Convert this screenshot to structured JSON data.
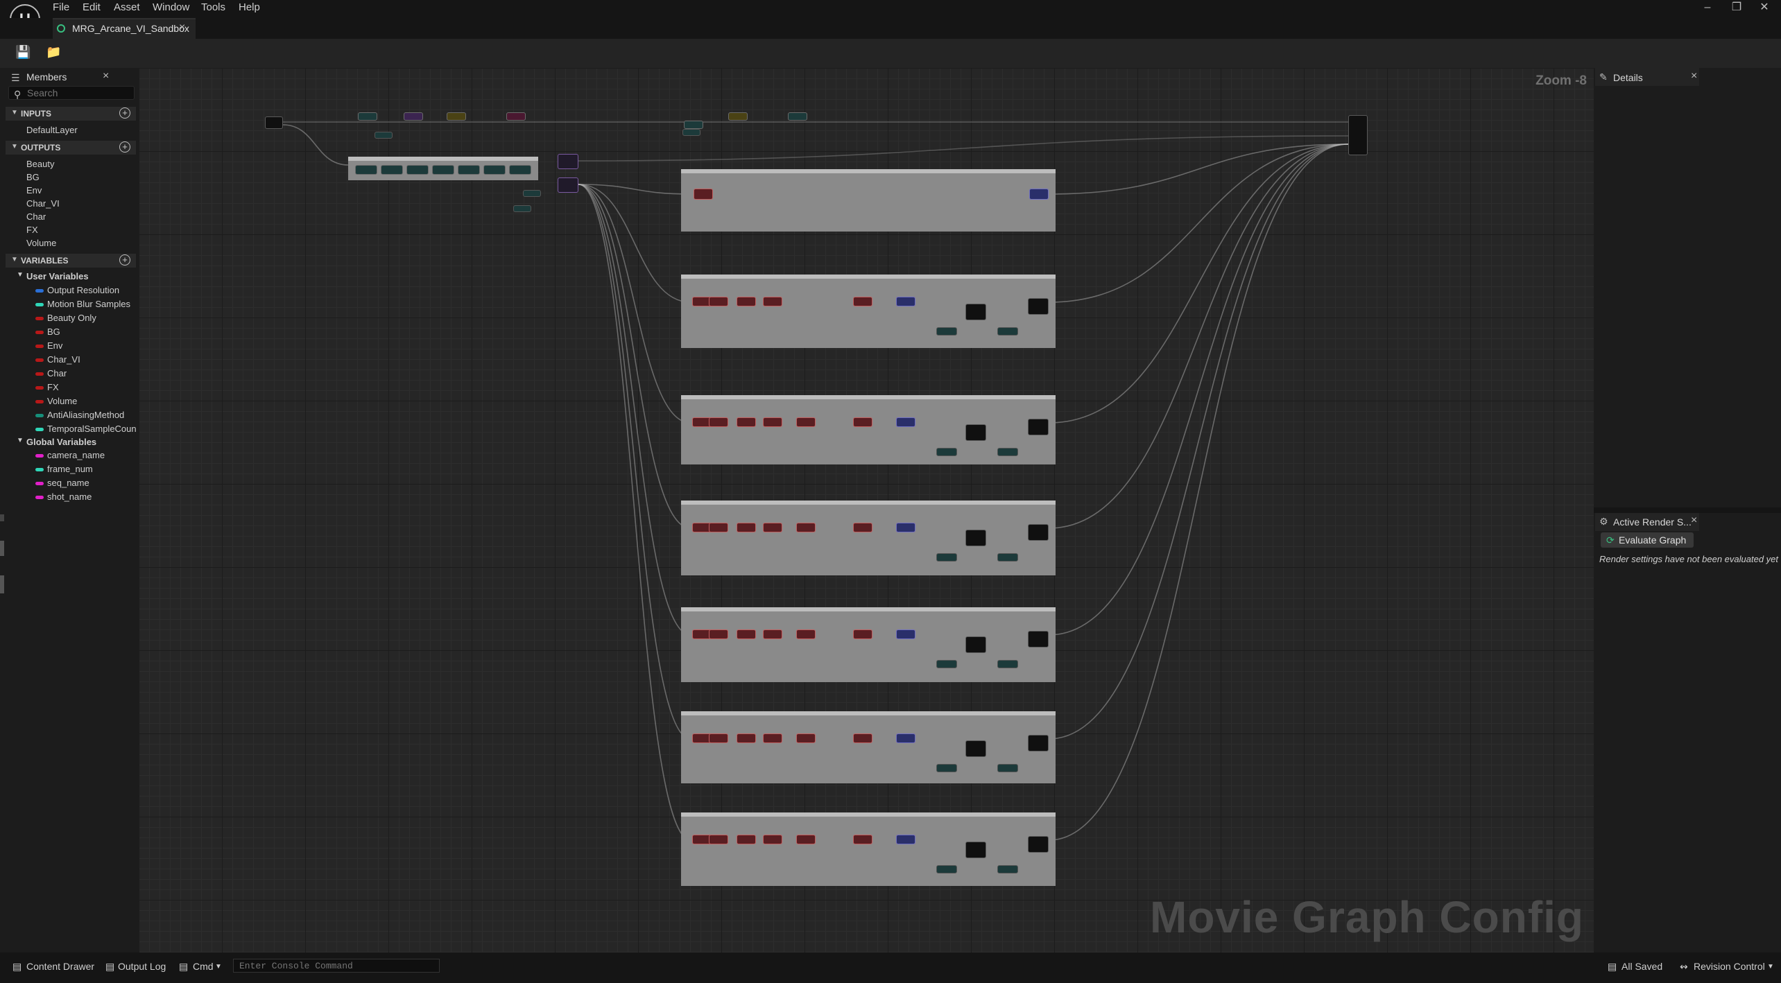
{
  "menubar": {
    "items": [
      "File",
      "Edit",
      "Asset",
      "Window",
      "Tools",
      "Help"
    ],
    "window_buttons": {
      "minimize": "–",
      "restore": "❐",
      "close": "✕"
    }
  },
  "document_tab": {
    "label": "MRG_Arcane_VI_Sandbox",
    "close": "×"
  },
  "members_panel": {
    "title": "Members",
    "close": "×",
    "search_placeholder": "Search",
    "sections": {
      "inputs": {
        "label": "INPUTS",
        "items": [
          "DefaultLayer"
        ]
      },
      "outputs": {
        "label": "OUTPUTS",
        "items": [
          "Beauty",
          "BG",
          "Env",
          "Char_VI",
          "Char",
          "FX",
          "Volume"
        ]
      },
      "variables": {
        "label": "VARIABLES",
        "user_group": {
          "label": "User Variables",
          "items": [
            {
              "label": "Output Resolution",
              "color": "#2a6fd6"
            },
            {
              "label": "Motion Blur Samples",
              "color": "#2fd6b8"
            },
            {
              "label": "Beauty Only",
              "color": "#b81818"
            },
            {
              "label": "BG",
              "color": "#b81818"
            },
            {
              "label": "Env",
              "color": "#b81818"
            },
            {
              "label": "Char_VI",
              "color": "#b81818"
            },
            {
              "label": "Char",
              "color": "#b81818"
            },
            {
              "label": "FX",
              "color": "#b81818"
            },
            {
              "label": "Volume",
              "color": "#b81818"
            },
            {
              "label": "AntiAliasingMethod",
              "color": "#168f7a"
            },
            {
              "label": "TemporalSampleCoun",
              "color": "#2fd6b8"
            }
          ]
        },
        "global_group": {
          "label": "Global Variables",
          "items": [
            {
              "label": "camera_name",
              "color": "#e020c8"
            },
            {
              "label": "frame_num",
              "color": "#2fd6b8"
            },
            {
              "label": "seq_name",
              "color": "#e020c8"
            },
            {
              "label": "shot_name",
              "color": "#e020c8"
            }
          ]
        }
      }
    }
  },
  "graph": {
    "zoom_label": "Zoom -8",
    "watermark": "Movie Graph Config"
  },
  "details_panel": {
    "title": "Details",
    "close": "×"
  },
  "active_render_panel": {
    "title": "Active Render S...",
    "close": "×",
    "evaluate_button": "Evaluate Graph",
    "status": "Render settings have not been evaluated yet"
  },
  "statusbar": {
    "content_drawer": "Content Drawer",
    "output_log": "Output Log",
    "cmd": "Cmd",
    "console_placeholder": "Enter Console Command",
    "saved": "All Saved",
    "revision_control": "Revision Control"
  },
  "colors": {
    "graph_bg": "#262626",
    "group_fill": "#8a8a8a",
    "node_red": "#5a1e22",
    "node_blue": "#2a2f6a",
    "node_teal": "#1c3a3a",
    "wire": "#bdbdbd"
  }
}
